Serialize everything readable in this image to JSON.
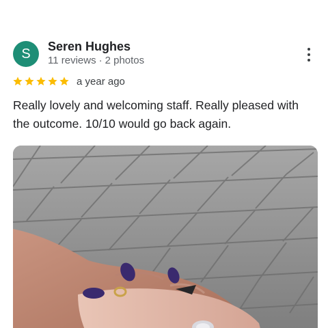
{
  "review": {
    "author_initial": "S",
    "author_name": "Seren Hughes",
    "reviews_count": "11 reviews",
    "photos_count": "2 photos",
    "rating": 5,
    "rating_max": 5,
    "age": "a year ago",
    "text": "Really lovely and welcoming staff. Really pleased with the outcome. 10/10 would go back again.",
    "photo_icon": "hand-with-painted-nails-photo",
    "more_icon": "more-vertical-icon"
  },
  "colors": {
    "avatar_bg": "#1e8e76",
    "star": "#fbbc04",
    "nail_polish": "#3a2a6e"
  }
}
